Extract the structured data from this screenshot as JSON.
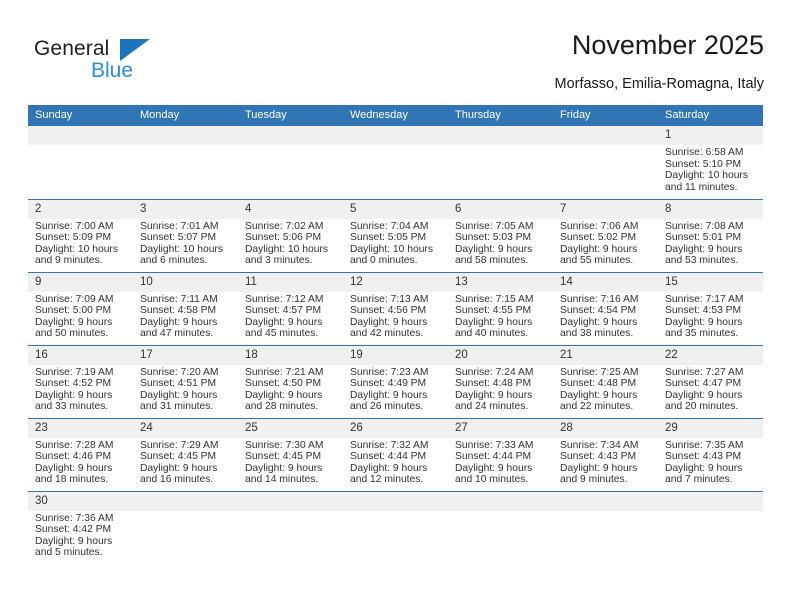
{
  "brand": {
    "name_part1": "General",
    "name_part2": "Blue",
    "triangle_color": "#1b75bb",
    "blue_color": "#2a8fd4"
  },
  "header": {
    "title": "November 2025",
    "subtitle": "Morfasso, Emilia-Romagna, Italy"
  },
  "theme": {
    "header_bg": "#3175b4",
    "row_line": "#3175b4",
    "daynum_bg": "#f0f0f0",
    "text": "#333333"
  },
  "weekdays": [
    "Sunday",
    "Monday",
    "Tuesday",
    "Wednesday",
    "Thursday",
    "Friday",
    "Saturday"
  ],
  "weeks": [
    [
      {
        "day": "",
        "blank": true
      },
      {
        "day": "",
        "blank": true
      },
      {
        "day": "",
        "blank": true
      },
      {
        "day": "",
        "blank": true
      },
      {
        "day": "",
        "blank": true
      },
      {
        "day": "",
        "blank": true
      },
      {
        "day": "1",
        "sunrise": "Sunrise: 6:58 AM",
        "sunset": "Sunset: 5:10 PM",
        "daylight1": "Daylight: 10 hours",
        "daylight2": "and 11 minutes."
      }
    ],
    [
      {
        "day": "2",
        "sunrise": "Sunrise: 7:00 AM",
        "sunset": "Sunset: 5:09 PM",
        "daylight1": "Daylight: 10 hours",
        "daylight2": "and 9 minutes."
      },
      {
        "day": "3",
        "sunrise": "Sunrise: 7:01 AM",
        "sunset": "Sunset: 5:07 PM",
        "daylight1": "Daylight: 10 hours",
        "daylight2": "and 6 minutes."
      },
      {
        "day": "4",
        "sunrise": "Sunrise: 7:02 AM",
        "sunset": "Sunset: 5:06 PM",
        "daylight1": "Daylight: 10 hours",
        "daylight2": "and 3 minutes."
      },
      {
        "day": "5",
        "sunrise": "Sunrise: 7:04 AM",
        "sunset": "Sunset: 5:05 PM",
        "daylight1": "Daylight: 10 hours",
        "daylight2": "and 0 minutes."
      },
      {
        "day": "6",
        "sunrise": "Sunrise: 7:05 AM",
        "sunset": "Sunset: 5:03 PM",
        "daylight1": "Daylight: 9 hours",
        "daylight2": "and 58 minutes."
      },
      {
        "day": "7",
        "sunrise": "Sunrise: 7:06 AM",
        "sunset": "Sunset: 5:02 PM",
        "daylight1": "Daylight: 9 hours",
        "daylight2": "and 55 minutes."
      },
      {
        "day": "8",
        "sunrise": "Sunrise: 7:08 AM",
        "sunset": "Sunset: 5:01 PM",
        "daylight1": "Daylight: 9 hours",
        "daylight2": "and 53 minutes."
      }
    ],
    [
      {
        "day": "9",
        "sunrise": "Sunrise: 7:09 AM",
        "sunset": "Sunset: 5:00 PM",
        "daylight1": "Daylight: 9 hours",
        "daylight2": "and 50 minutes."
      },
      {
        "day": "10",
        "sunrise": "Sunrise: 7:11 AM",
        "sunset": "Sunset: 4:58 PM",
        "daylight1": "Daylight: 9 hours",
        "daylight2": "and 47 minutes."
      },
      {
        "day": "11",
        "sunrise": "Sunrise: 7:12 AM",
        "sunset": "Sunset: 4:57 PM",
        "daylight1": "Daylight: 9 hours",
        "daylight2": "and 45 minutes."
      },
      {
        "day": "12",
        "sunrise": "Sunrise: 7:13 AM",
        "sunset": "Sunset: 4:56 PM",
        "daylight1": "Daylight: 9 hours",
        "daylight2": "and 42 minutes."
      },
      {
        "day": "13",
        "sunrise": "Sunrise: 7:15 AM",
        "sunset": "Sunset: 4:55 PM",
        "daylight1": "Daylight: 9 hours",
        "daylight2": "and 40 minutes."
      },
      {
        "day": "14",
        "sunrise": "Sunrise: 7:16 AM",
        "sunset": "Sunset: 4:54 PM",
        "daylight1": "Daylight: 9 hours",
        "daylight2": "and 38 minutes."
      },
      {
        "day": "15",
        "sunrise": "Sunrise: 7:17 AM",
        "sunset": "Sunset: 4:53 PM",
        "daylight1": "Daylight: 9 hours",
        "daylight2": "and 35 minutes."
      }
    ],
    [
      {
        "day": "16",
        "sunrise": "Sunrise: 7:19 AM",
        "sunset": "Sunset: 4:52 PM",
        "daylight1": "Daylight: 9 hours",
        "daylight2": "and 33 minutes."
      },
      {
        "day": "17",
        "sunrise": "Sunrise: 7:20 AM",
        "sunset": "Sunset: 4:51 PM",
        "daylight1": "Daylight: 9 hours",
        "daylight2": "and 31 minutes."
      },
      {
        "day": "18",
        "sunrise": "Sunrise: 7:21 AM",
        "sunset": "Sunset: 4:50 PM",
        "daylight1": "Daylight: 9 hours",
        "daylight2": "and 28 minutes."
      },
      {
        "day": "19",
        "sunrise": "Sunrise: 7:23 AM",
        "sunset": "Sunset: 4:49 PM",
        "daylight1": "Daylight: 9 hours",
        "daylight2": "and 26 minutes."
      },
      {
        "day": "20",
        "sunrise": "Sunrise: 7:24 AM",
        "sunset": "Sunset: 4:48 PM",
        "daylight1": "Daylight: 9 hours",
        "daylight2": "and 24 minutes."
      },
      {
        "day": "21",
        "sunrise": "Sunrise: 7:25 AM",
        "sunset": "Sunset: 4:48 PM",
        "daylight1": "Daylight: 9 hours",
        "daylight2": "and 22 minutes."
      },
      {
        "day": "22",
        "sunrise": "Sunrise: 7:27 AM",
        "sunset": "Sunset: 4:47 PM",
        "daylight1": "Daylight: 9 hours",
        "daylight2": "and 20 minutes."
      }
    ],
    [
      {
        "day": "23",
        "sunrise": "Sunrise: 7:28 AM",
        "sunset": "Sunset: 4:46 PM",
        "daylight1": "Daylight: 9 hours",
        "daylight2": "and 18 minutes."
      },
      {
        "day": "24",
        "sunrise": "Sunrise: 7:29 AM",
        "sunset": "Sunset: 4:45 PM",
        "daylight1": "Daylight: 9 hours",
        "daylight2": "and 16 minutes."
      },
      {
        "day": "25",
        "sunrise": "Sunrise: 7:30 AM",
        "sunset": "Sunset: 4:45 PM",
        "daylight1": "Daylight: 9 hours",
        "daylight2": "and 14 minutes."
      },
      {
        "day": "26",
        "sunrise": "Sunrise: 7:32 AM",
        "sunset": "Sunset: 4:44 PM",
        "daylight1": "Daylight: 9 hours",
        "daylight2": "and 12 minutes."
      },
      {
        "day": "27",
        "sunrise": "Sunrise: 7:33 AM",
        "sunset": "Sunset: 4:44 PM",
        "daylight1": "Daylight: 9 hours",
        "daylight2": "and 10 minutes."
      },
      {
        "day": "28",
        "sunrise": "Sunrise: 7:34 AM",
        "sunset": "Sunset: 4:43 PM",
        "daylight1": "Daylight: 9 hours",
        "daylight2": "and 9 minutes."
      },
      {
        "day": "29",
        "sunrise": "Sunrise: 7:35 AM",
        "sunset": "Sunset: 4:43 PM",
        "daylight1": "Daylight: 9 hours",
        "daylight2": "and 7 minutes."
      }
    ],
    [
      {
        "day": "30",
        "sunrise": "Sunrise: 7:36 AM",
        "sunset": "Sunset: 4:42 PM",
        "daylight1": "Daylight: 9 hours",
        "daylight2": "and 5 minutes."
      },
      {
        "day": "",
        "blank": true
      },
      {
        "day": "",
        "blank": true
      },
      {
        "day": "",
        "blank": true
      },
      {
        "day": "",
        "blank": true
      },
      {
        "day": "",
        "blank": true
      },
      {
        "day": "",
        "blank": true
      }
    ]
  ]
}
